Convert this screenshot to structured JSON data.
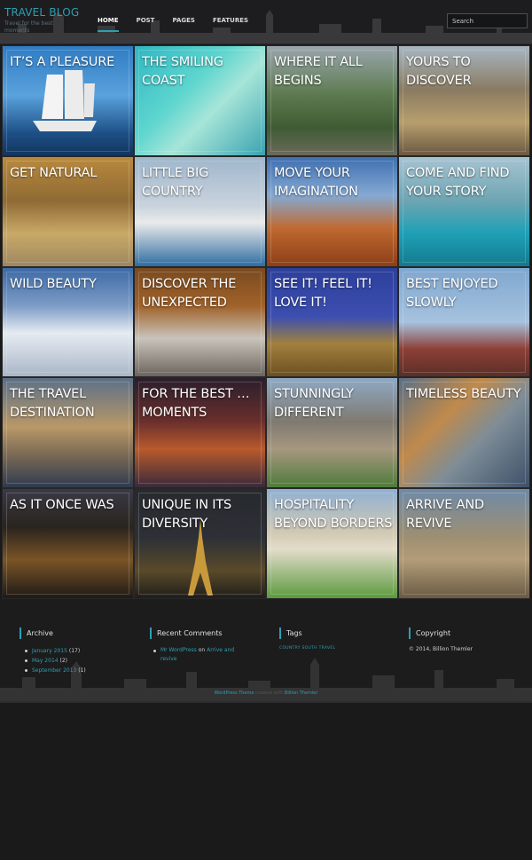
{
  "brand": {
    "title": "TRAVEL BLOG",
    "tagline": "Travel for the best moments"
  },
  "nav": {
    "items": [
      "HOME",
      "POST",
      "PAGES",
      "FEATURES"
    ],
    "active": "HOME"
  },
  "search": {
    "placeholder": "Search"
  },
  "tiles": [
    {
      "title": "IT’S A PLEASURE"
    },
    {
      "title": "THE SMILING COAST"
    },
    {
      "title": "WHERE IT ALL BEGINS"
    },
    {
      "title": "YOURS TO DISCOVER"
    },
    {
      "title": "GET NATURAL"
    },
    {
      "title": "LITTLE BIG COUNTRY"
    },
    {
      "title": "MOVE YOUR IMAGINATION"
    },
    {
      "title": "COME AND FIND YOUR STORY"
    },
    {
      "title": "WILD BEAUTY"
    },
    {
      "title": "DISCOVER THE UNEXPECTED"
    },
    {
      "title": "SEE IT! FEEL IT! LOVE IT!"
    },
    {
      "title": "BEST ENJOYED SLOWLY"
    },
    {
      "title": "THE TRAVEL DESTINATION"
    },
    {
      "title": "FOR THE BEST … MOMENTS"
    },
    {
      "title": "STUNNINGLY DIFFERENT"
    },
    {
      "title": "TIMELESS BEAUTY"
    },
    {
      "title": "AS IT ONCE WAS"
    },
    {
      "title": "UNIQUE IN ITS DIVERSITY"
    },
    {
      "title": "HOSPITALITY BEYOND BORDERS"
    },
    {
      "title": "ARRIVE AND REVIVE"
    }
  ],
  "footer": {
    "archive": {
      "title": "Archive",
      "items": [
        {
          "label": "January 2015",
          "count": "(17)"
        },
        {
          "label": "May 2014",
          "count": "(2)"
        },
        {
          "label": "September 2013",
          "count": "(1)"
        }
      ]
    },
    "recent_comments": {
      "title": "Recent Comments",
      "author": "Mr WordPress",
      "on": "on",
      "post": "Arrive and revive"
    },
    "tags": {
      "title": "Tags",
      "text": "COUNTRY SOUTH TRAVEL"
    },
    "copyright": {
      "title": "Copyright",
      "text": "© 2014, Billion Themler"
    },
    "credit": {
      "theme": "WordPress Theme",
      "created": "created with",
      "tool": "Billion Themler"
    }
  },
  "colors": {
    "accent": "#2f9eaf",
    "background": "#1a1a1b"
  }
}
